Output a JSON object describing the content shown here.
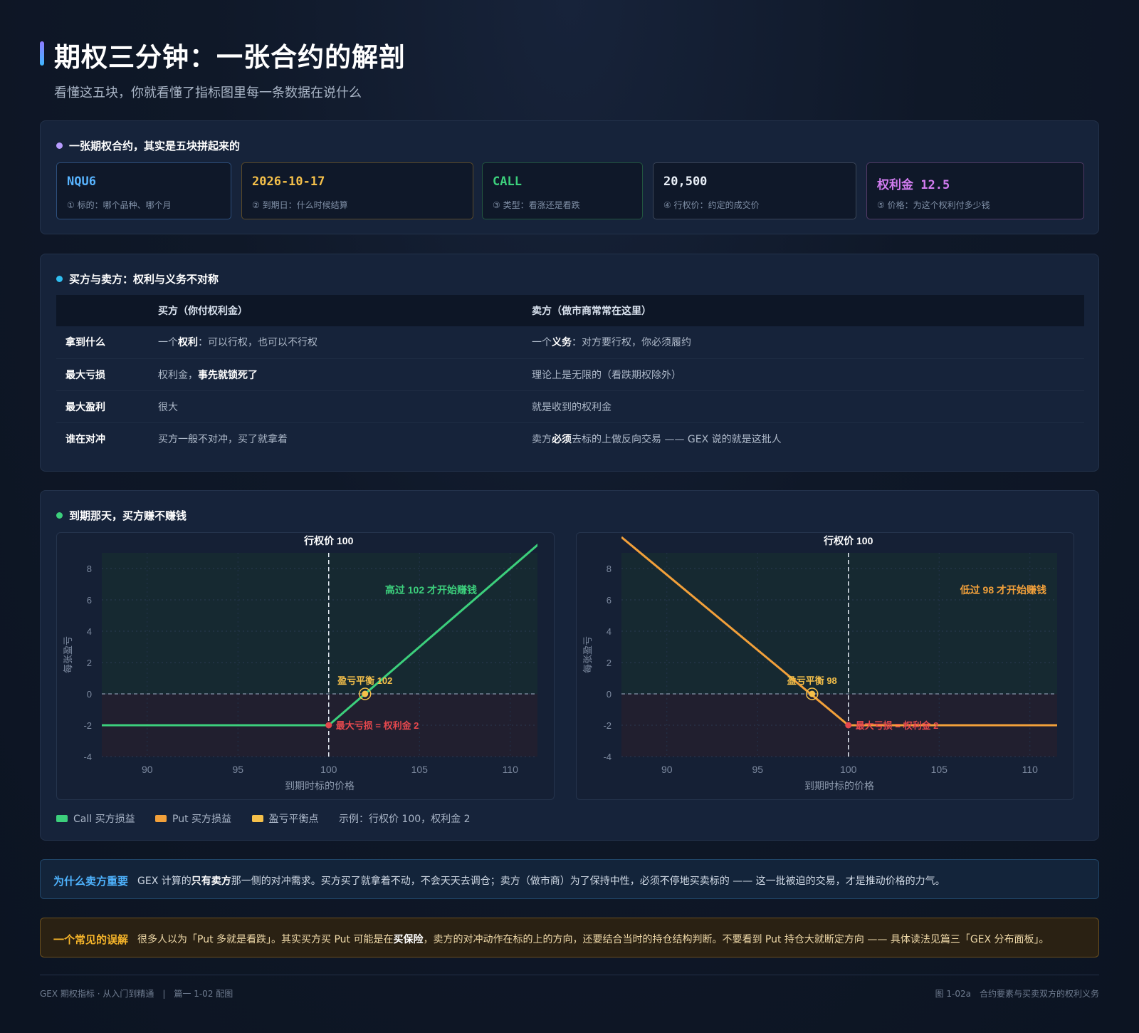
{
  "header": {
    "title": "期权三分钟：一张合约的解剖",
    "subtitle": "看懂这五块，你就看懂了指标图里每一条数据在说什么"
  },
  "anatomy": {
    "heading": "一张期权合约，其实是五块拼起来的",
    "accent": "#b79cff",
    "cards": [
      {
        "value": "NQU6",
        "desc": "① 标的：哪个品种、哪个月",
        "color": "#58b4ff"
      },
      {
        "value": "2026-10-17",
        "desc": "② 到期日：什么时候结算",
        "color": "#f5c04a"
      },
      {
        "value": "CALL",
        "desc": "③ 类型：看涨还是看跌",
        "color": "#3ccf7c"
      },
      {
        "value": "20,500",
        "desc": "④ 行权价：约定的成交价",
        "color": "#eaf0f8"
      },
      {
        "value": "权利金 12.5",
        "desc": "⑤ 价格：为这个权利付多少钱",
        "color": "#d27cf0"
      }
    ]
  },
  "compare": {
    "heading": "买方与卖方：权利与义务不对称",
    "accent": "#2fbef0",
    "col_buyer": "买方（你付权利金）",
    "col_seller": "卖方（做市商常常在这里）",
    "rows": [
      {
        "label": "拿到什么",
        "buyer_pre": "一个",
        "buyer_bold": "权利",
        "buyer_post": "：可以行权，也可以不行权",
        "seller_pre": "一个",
        "seller_bold": "义务",
        "seller_post": "：对方要行权，你必须履约"
      },
      {
        "label": "最大亏损",
        "buyer_pre": "权利金，",
        "buyer_bold": "事先就锁死了",
        "buyer_post": "",
        "seller_pre": "理论上是无限的（看跌期权除外）",
        "seller_bold": "",
        "seller_post": ""
      },
      {
        "label": "最大盈利",
        "buyer_pre": "很大",
        "buyer_bold": "",
        "buyer_post": "",
        "seller_pre": "就是收到的权利金",
        "seller_bold": "",
        "seller_post": ""
      },
      {
        "label": "谁在对冲",
        "buyer_pre": "买方一般不对冲，买了就拿着",
        "buyer_bold": "",
        "buyer_post": "",
        "seller_pre": "卖方",
        "seller_bold": "必须",
        "seller_post": "去标的上做反向交易 —— GEX 说的就是这批人"
      }
    ]
  },
  "payoff": {
    "heading": "到期那天，买方赚不赚钱",
    "accent": "#3ccf7c",
    "legend": {
      "call": "Call 买方损益",
      "put": "Put 买方损益",
      "breakeven": "盈亏平衡点",
      "note": "示例：行权价 100，权利金 2"
    },
    "colors": {
      "call": "#3ccf7c",
      "put": "#f2a03a",
      "breakeven": "#f5c04a",
      "loss": "#e5484d"
    }
  },
  "chart_data": [
    {
      "type": "line",
      "title": "行权价 100",
      "xlabel": "到期时标的价格",
      "ylabel": "每张盈亏",
      "xlim": [
        87.5,
        111.5
      ],
      "ylim": [
        -4,
        9
      ],
      "xticks": [
        90,
        95,
        100,
        105,
        110
      ],
      "yticks": [
        -4,
        -2,
        0,
        2,
        4,
        6,
        8
      ],
      "series": [
        {
          "name": "Call 买方损益",
          "x": [
            87.5,
            100,
            112.2
          ],
          "y": [
            -2,
            -2,
            10.2
          ]
        }
      ],
      "strike": 100,
      "breakeven": {
        "x": 102,
        "y": 0,
        "label": "盈亏平衡 102"
      },
      "max_loss": {
        "x": 100,
        "y": -2,
        "label": "最大亏损 = 权利金 2"
      },
      "annotation": "高过 102 才开始赚钱"
    },
    {
      "type": "line",
      "title": "行权价 100",
      "xlabel": "到期时标的价格",
      "ylabel": "每张盈亏",
      "xlim": [
        87.5,
        111.5
      ],
      "ylim": [
        -4,
        9
      ],
      "xticks": [
        90,
        95,
        100,
        105,
        110
      ],
      "yticks": [
        -4,
        -2,
        0,
        2,
        4,
        6,
        8
      ],
      "series": [
        {
          "name": "Put 买方损益",
          "x": [
            87.5,
            100,
            111.5
          ],
          "y": [
            10,
            -2,
            -2
          ]
        }
      ],
      "strike": 100,
      "breakeven": {
        "x": 98,
        "y": 0,
        "label": "盈亏平衡 98"
      },
      "max_loss": {
        "x": 100,
        "y": -2,
        "label": "最大亏损 = 权利金 2"
      },
      "annotation": "低过 98 才开始赚钱"
    }
  ],
  "why_seller": {
    "key": "为什么卖方重要",
    "pre": "GEX 计算的",
    "bold": "只有卖方",
    "post": "那一侧的对冲需求。买方买了就拿着不动，不会天天去调仓；卖方（做市商）为了保持中性，必须不停地买卖标的 —— 这一批被迫的交易，才是推动价格的力气。"
  },
  "misconception": {
    "key": "一个常见的误解",
    "pre": "很多人以为「Put 多就是看跌」。其实买方买 Put 可能是在",
    "bold": "买保险",
    "post": "，卖方的对冲动作在标的上的方向，还要结合当时的持仓结构判断。不要看到 Put 持仓大就断定方向 —— 具体读法见篇三「GEX 分布面板」。"
  },
  "footer": {
    "left": "GEX 期权指标 · 从入门到精通　|　篇一 1-02 配图",
    "right": "图 1-02a　合约要素与买卖双方的权利义务"
  }
}
